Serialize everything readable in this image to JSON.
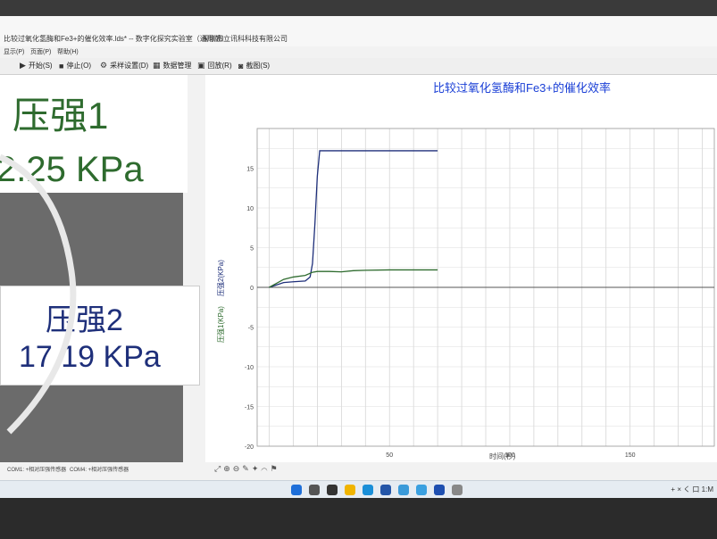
{
  "window": {
    "title": "比较过氧化氢酶和Fe3+的催化效率.lds* -- 数字化探究实验室（通用版）",
    "company": "深圳市立讯科科技有限公司"
  },
  "menu": [
    "显示(P)",
    "页面(P)",
    "帮助(H)"
  ],
  "toolbar": {
    "start": "开始(S)",
    "stop": "停止(O)",
    "sampling": "采样设置(D)",
    "data": "数据管理",
    "replay": "回放(R)",
    "screenshot": "截图(S)"
  },
  "sensors": {
    "s1": {
      "label": "压强1",
      "value": "2.25 KPa"
    },
    "s2": {
      "label": "压强2",
      "value": "17.19 KPa"
    }
  },
  "status": {
    "com1": "COM1: +相对压强传感器",
    "com4": "COM4: +相对压强传感器"
  },
  "taskbar": {
    "tray": "+ ×  く  口 1:M"
  },
  "colors": {
    "series1": "#2e6b2e",
    "series2": "#1e2f7a",
    "title": "#1a3fd6"
  },
  "chart_data": {
    "type": "line",
    "title": "比较过氧化氢酶和Fe3+的催化效率",
    "xlabel": "时间(秒)",
    "ylabels": [
      "压强2(KPa)",
      "压强1(KPa)"
    ],
    "xlim": [
      -5,
      185
    ],
    "ylim": [
      -20,
      20
    ],
    "xticks": [
      50,
      100,
      150
    ],
    "yticks": [
      15,
      10,
      5,
      0,
      -5,
      -10,
      -15,
      -20
    ],
    "grid": true,
    "series": [
      {
        "name": "压强2(KPa)",
        "color": "#1e2f7a",
        "x": [
          0,
          3,
          6,
          10,
          15,
          17,
          18,
          19,
          20,
          21,
          22,
          35,
          50,
          70
        ],
        "y": [
          0,
          0.3,
          0.6,
          0.7,
          0.8,
          1.3,
          3,
          8,
          14,
          17.2,
          17.2,
          17.2,
          17.2,
          17.2
        ]
      },
      {
        "name": "压强1(KPa)",
        "color": "#2e6b2e",
        "x": [
          0,
          3,
          6,
          10,
          15,
          18,
          20,
          25,
          30,
          35,
          40,
          50,
          60,
          70
        ],
        "y": [
          0,
          0.5,
          1.0,
          1.3,
          1.5,
          1.9,
          2.0,
          2.0,
          1.95,
          2.1,
          2.15,
          2.2,
          2.2,
          2.2
        ]
      }
    ]
  }
}
